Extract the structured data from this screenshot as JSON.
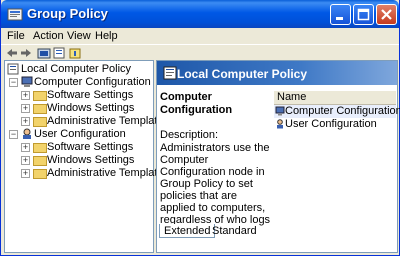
{
  "window": {
    "title": "Group Policy",
    "icons": {
      "app": "group-policy-icon",
      "min": "minimize-icon",
      "max": "maximize-icon",
      "close": "close-icon"
    }
  },
  "menu": {
    "file": "File",
    "action": "Action",
    "view": "View",
    "help": "Help"
  },
  "toolbar": {
    "back_icon": "back-arrow-icon",
    "forward_icon": "forward-arrow-icon",
    "up_icon": "up-folder-icon",
    "properties_icon": "properties-icon",
    "help_icon": "help-icon"
  },
  "tree": {
    "root": "Local Computer Policy",
    "computer_configuration": "Computer Configuration",
    "software_settings_1": "Software Settings",
    "windows_settings_1": "Windows Settings",
    "admin_templates_1": "Administrative Templates",
    "user_configuration": "User Configuration",
    "software_settings_2": "Software Settings",
    "windows_settings_2": "Windows Settings",
    "admin_templates_2": "Administrative Templates"
  },
  "right": {
    "header": "Local Computer Policy",
    "desc_title": "Computer Configuration",
    "desc_label": "Description:",
    "desc_text": "Administrators use the Computer Configuration node in Group Policy to set policies that are applied to computers, regardless of who logs onto them.",
    "list_header": "Name",
    "list_items": [
      "Computer Configuration",
      "User Configuration"
    ]
  },
  "tabs": {
    "extended": "Extended",
    "standard": "Standard"
  },
  "colors": {
    "titlebar": "#0058e6",
    "header_gradient_start": "#1e57a8",
    "window_bg": "#ece9d8"
  }
}
